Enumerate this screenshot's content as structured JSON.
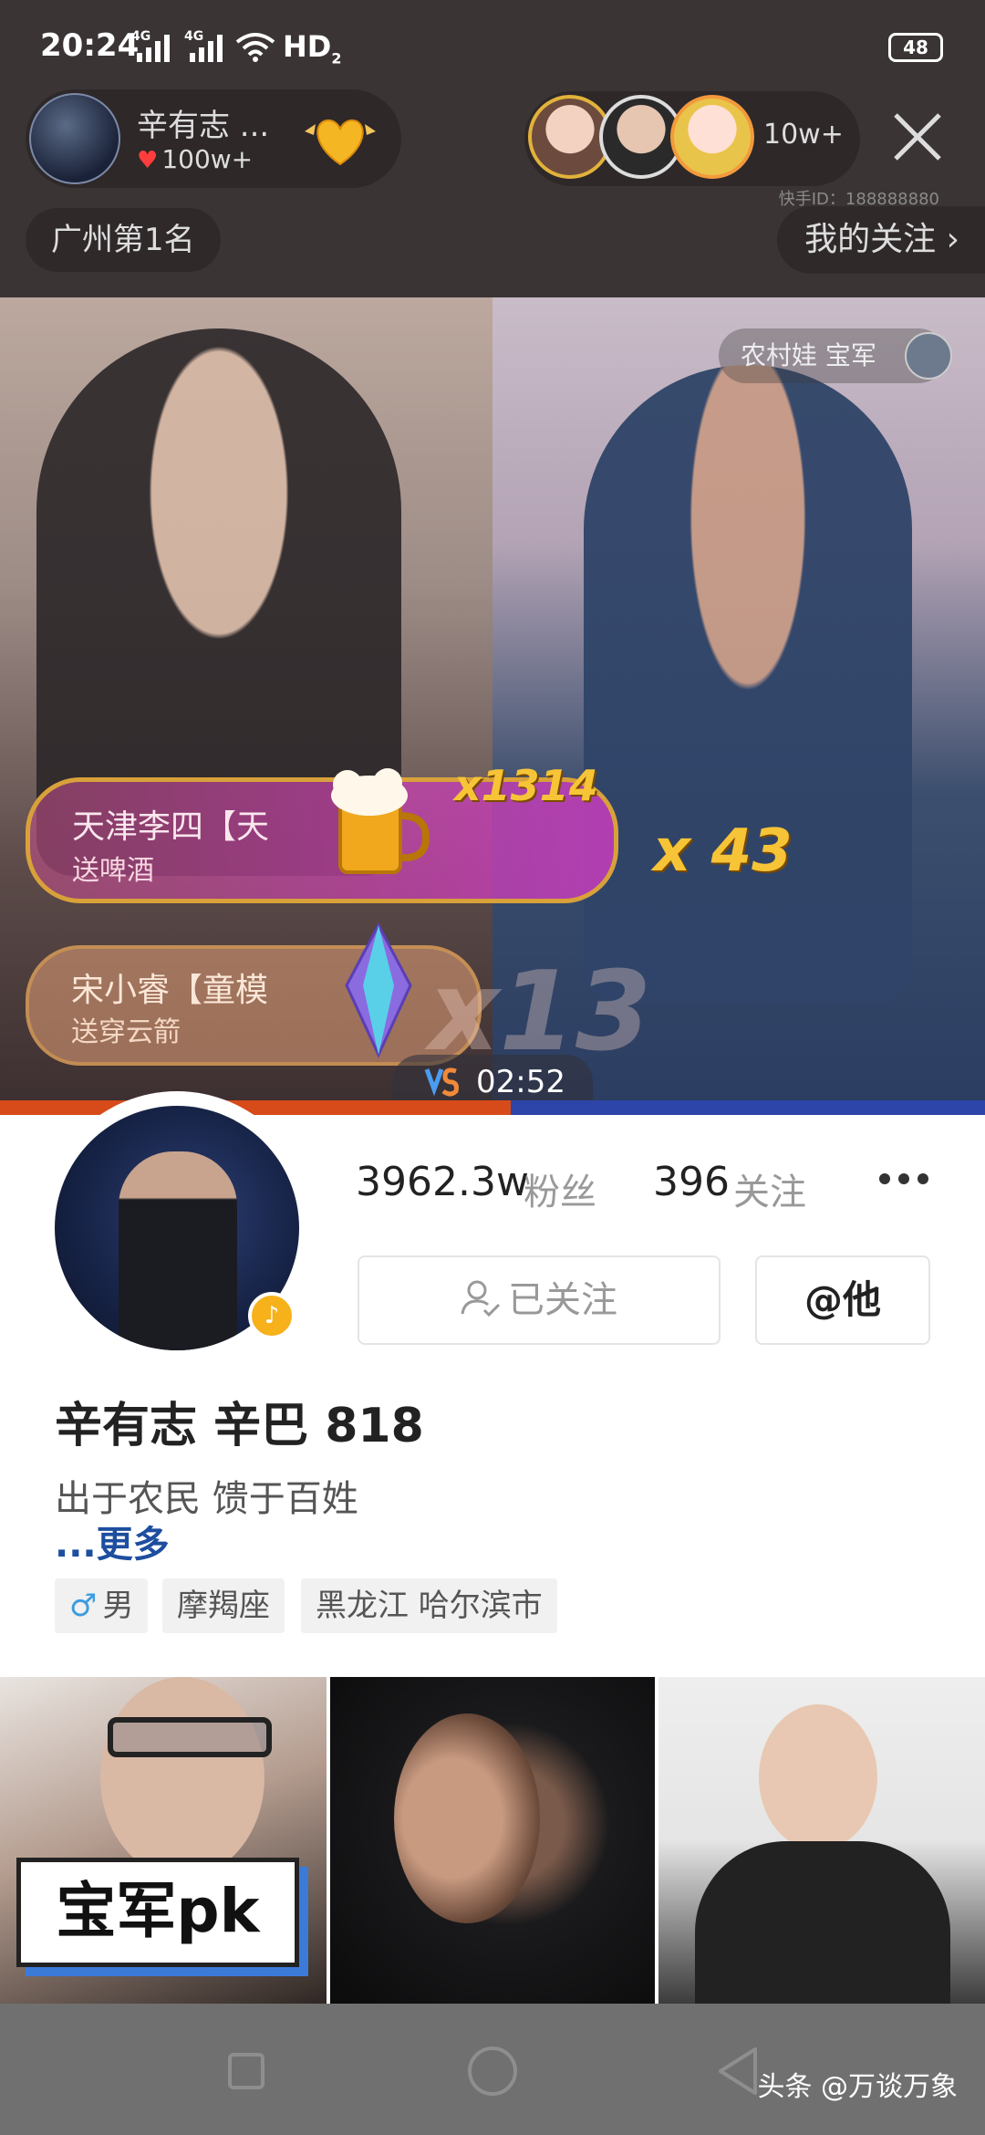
{
  "status_bar": {
    "time": "20:24",
    "network1": "4G",
    "network2": "4G",
    "hd": "HD",
    "hd_sub": "2",
    "battery": "48"
  },
  "live": {
    "host_name": "辛有志 ...",
    "host_likes": "100w+",
    "viewers_count": "10w+",
    "kuaishou_id": "快手ID：188888880",
    "rank": "广州第1名",
    "my_follow": "我的关注",
    "opponent_name": "农村娃 宝军",
    "gifts": [
      {
        "sender": "天津李四【天",
        "action": "送啤酒",
        "combo": "x1314"
      },
      {
        "sender": "宋小睿【童模",
        "action": "送穿云箭",
        "combo": "x13"
      }
    ],
    "right_combo": "x 43",
    "timer": "02:52",
    "colors": {
      "pk_left": "#d74b1a",
      "pk_right": "#2d44a8",
      "gift_border": "#d8a13a"
    }
  },
  "profile": {
    "fans_count": "3962.3w",
    "fans_label": "粉丝",
    "following_count": "396",
    "following_label": "关注",
    "followed_button": "已关注",
    "at_button": "@他",
    "name": "辛有志 辛巴 818",
    "bio": "出于农民 馈于百姓",
    "more_link": "...更多",
    "tags": [
      "男",
      "摩羯座",
      "黑龙江 哈尔滨市"
    ],
    "link_color": "#1d4e9f"
  },
  "videos": {
    "sticker_text": "宝军pk"
  },
  "watermark": "头条 @万谈万象"
}
